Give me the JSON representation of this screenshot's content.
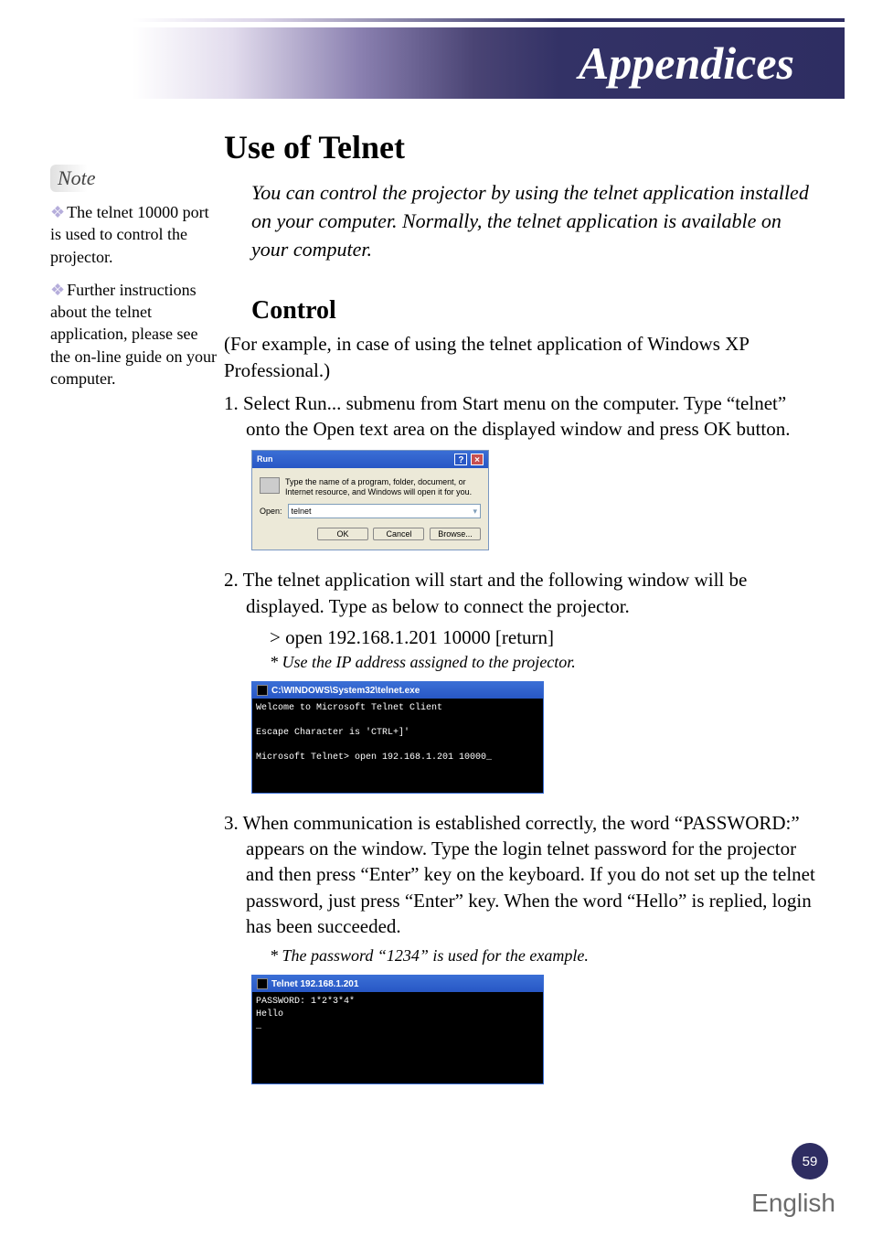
{
  "header": {
    "title": "Appendices"
  },
  "sidebar": {
    "note_label": "Note",
    "note1": "The telnet 10000 port is used to control the projector.",
    "note2": "Further instructions about the telnet application, please see the on-line guide on your computer."
  },
  "main": {
    "section_title": "Use of Telnet",
    "intro": "You can control the projector by using the telnet application installed on your computer. Normally, the telnet application is available on your computer.",
    "sub_title": "Control",
    "example_note": "(For example, in case of using the telnet application of Windows XP Professional.)",
    "step1": "1. Select Run... submenu from Start menu on the computer. Type “telnet” onto the Open text area on the displayed window and press OK button.",
    "step2": "2. The telnet application will start and the following window will be displayed. Type as below to connect the projector.",
    "step2_cmd": "> open 192.168.1.201 10000 [return]",
    "step2_foot": "* Use the IP address assigned to the projector.",
    "step3": "3. When communication is established correctly, the word “PASSWORD:” appears on the window. Type the login telnet password for the projector and then press “Enter” key on the keyboard. If you do not set up the telnet password, just press “Enter” key. When the word “Hello” is replied, login has been succeeded.",
    "step3_foot": "* The password “1234” is used for the example."
  },
  "run_dialog": {
    "title": "Run",
    "desc": "Type the name of a program, folder, document, or Internet resource, and Windows will open it for you.",
    "open_label": "Open:",
    "input_value": "telnet",
    "ok": "OK",
    "cancel": "Cancel",
    "browse": "Browse..."
  },
  "terminal1": {
    "title": "C:\\WINDOWS\\System32\\telnet.exe",
    "line1": "Welcome to Microsoft Telnet Client",
    "line2": "Escape Character is 'CTRL+]'",
    "line3": "Microsoft Telnet> open 192.168.1.201 10000_"
  },
  "terminal2": {
    "title": "Telnet 192.168.1.201",
    "line1": "PASSWORD: 1*2*3*4*",
    "line2": "Hello",
    "line3": "_"
  },
  "footer": {
    "page": "59",
    "language": "English"
  }
}
